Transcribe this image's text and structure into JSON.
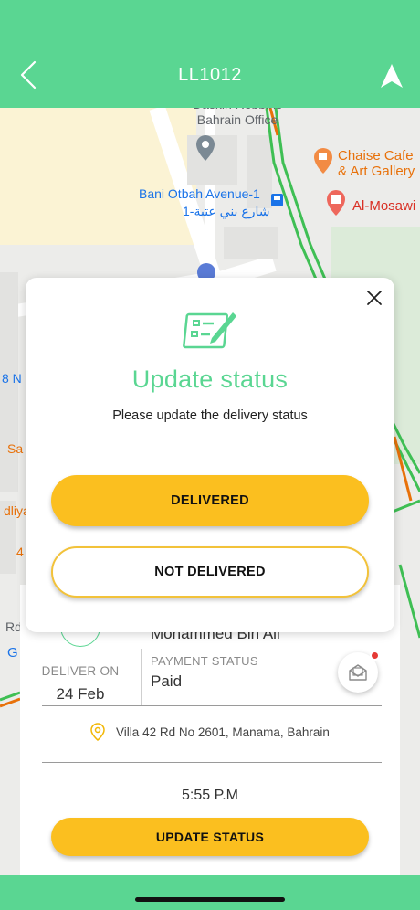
{
  "header": {
    "title": "LL1012",
    "back_icon": "chevron-left-icon",
    "navigate_icon": "navigation-arrow-icon"
  },
  "map": {
    "labels": {
      "poi_top": "Daskin Robbins\nBahrain Office",
      "cafe": "Chaise Cafe\n& Art Gallery",
      "bus_stop": "Bani Otbah Avenue-1",
      "bus_stop_ar": "شارع بني عتبة-1",
      "pharmacy": "Al-Mosawi",
      "left_n": "8 N",
      "left_sa": "Sa",
      "left_dliya": "dliya",
      "left_4": "4",
      "left_rd": "Rd",
      "left_g": "G"
    }
  },
  "sheet": {
    "customer_name": "Mohammed Bin Ali",
    "deliver_on_label": "DELIVER ON",
    "deliver_on_value": "24 Feb",
    "payment_status_label": "PAYMENT STATUS",
    "payment_status_value": "Paid",
    "address": "Villa 42 Rd No 2601, Manama, Bahrain",
    "time": "5:55 P.M",
    "update_button": "UPDATE STATUS"
  },
  "modal": {
    "title": "Update status",
    "subtitle": "Please update the delivery status",
    "delivered_button": "DELIVERED",
    "not_delivered_button": "NOT DELIVERED"
  },
  "colors": {
    "brand_green": "#5ad692",
    "accent_yellow": "#fbbf1f",
    "notification_red": "#e53935"
  }
}
